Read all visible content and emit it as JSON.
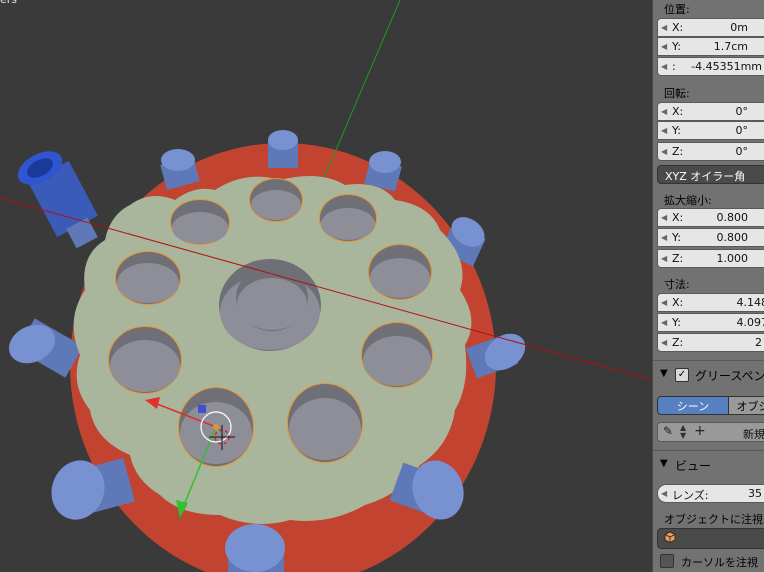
{
  "viewport": {
    "corner_text": "ers"
  },
  "panel": {
    "location": {
      "label": "位置:",
      "x": {
        "key": "X:",
        "value": "0m"
      },
      "y": {
        "key": "Y:",
        "value": "1.7cm"
      },
      "z": {
        "key": ":",
        "value": "-4.45351mm"
      }
    },
    "rotation": {
      "label": "回転:",
      "x": {
        "key": "X:",
        "value": "0°"
      },
      "y": {
        "key": "Y:",
        "value": "0°"
      },
      "z": {
        "key": "Z:",
        "value": "0°"
      },
      "mode": "XYZ オイラー角"
    },
    "scale": {
      "label": "拡大縮小:",
      "x": {
        "key": "X:",
        "value": "0.800"
      },
      "y": {
        "key": "Y:",
        "value": "0.800"
      },
      "z": {
        "key": "Z:",
        "value": "1.000"
      }
    },
    "dimensions": {
      "label": "寸法:",
      "x": {
        "key": "X:",
        "value": "4.148"
      },
      "y": {
        "key": "Y:",
        "value": "4.097"
      },
      "z": {
        "key": "Z:",
        "value": "2"
      }
    },
    "grease_pencil": {
      "title": "グリースペン",
      "tab_scene": "シーン",
      "tab_object": "オブジ",
      "new_label": "新規"
    },
    "view": {
      "title": "ビュー",
      "lens": {
        "key": "レンズ:",
        "value": "35"
      },
      "lock_to_object": "オブジェクトに注視",
      "lock_to_cursor": "カーソルを注視"
    }
  },
  "colors": {
    "viewport_bg": "#3a3a3a",
    "base_disc": "#c2432f",
    "top_plate": "#a9b69b",
    "pin_blue": "#6d86c6",
    "hole_gray": "#8e8e99",
    "selection_orange": "#e8932d",
    "axis_red": "#b01010",
    "axis_green": "#1f9a1f"
  }
}
